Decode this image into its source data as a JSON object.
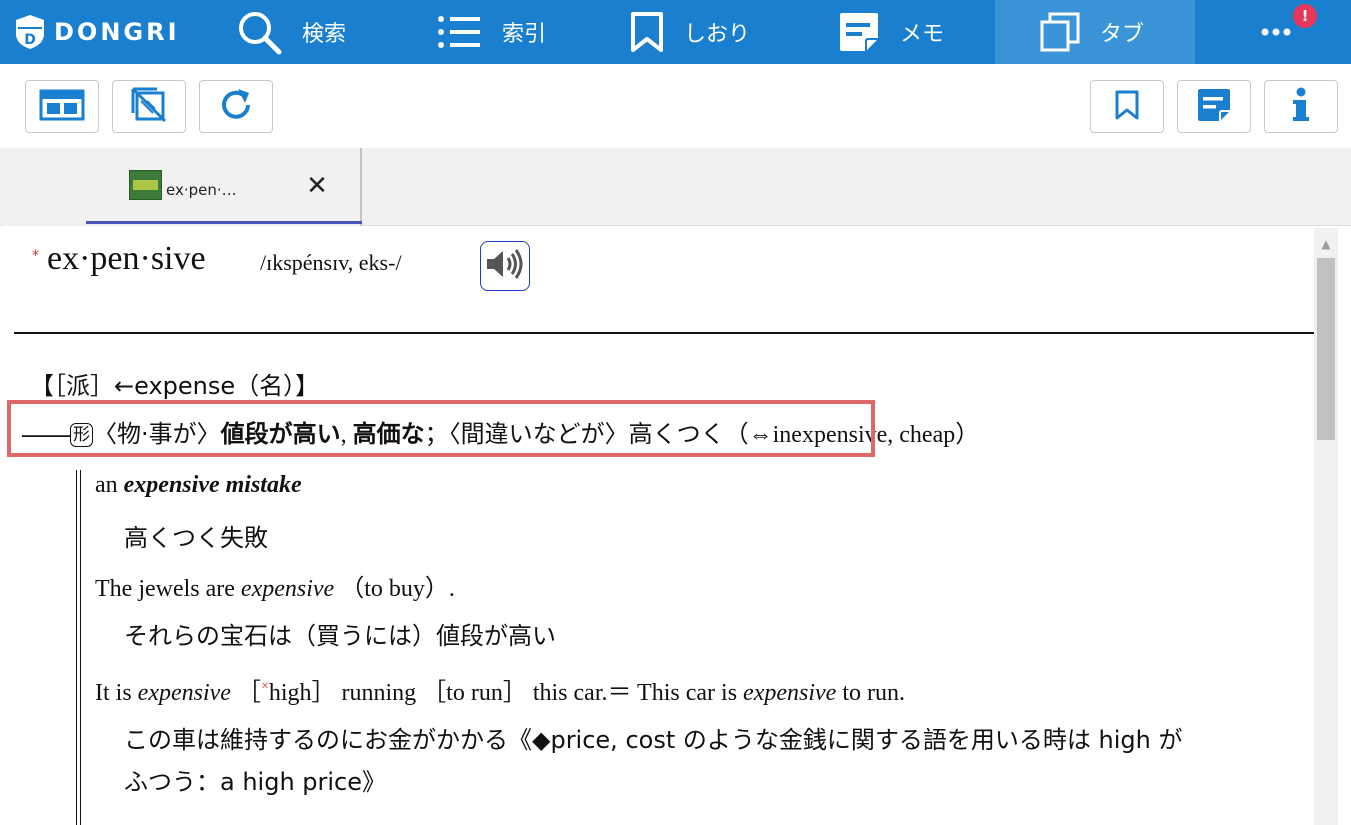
{
  "app": {
    "logo_text": "DONGRI",
    "nav": [
      {
        "label": "検索",
        "icon": "search-icon"
      },
      {
        "label": "索引",
        "icon": "list-icon"
      },
      {
        "label": "しおり",
        "icon": "bookmark-icon"
      },
      {
        "label": "メモ",
        "icon": "memo-icon"
      },
      {
        "label": "タブ",
        "icon": "tabs-icon"
      }
    ],
    "more_icon": "more-icon",
    "badge": "!",
    "accent_color": "#1a7fcf",
    "badge_color": "#e8385a",
    "highlight_color": "#e06767"
  },
  "toolbar": {
    "left_buttons": [
      "layout-icon",
      "no-image-icon",
      "refresh-icon"
    ],
    "right_buttons": [
      "bookmark-icon",
      "memo-icon",
      "info-icon"
    ]
  },
  "tab": {
    "title": "ex·pen·…",
    "close": "✕"
  },
  "entry": {
    "star": "*",
    "headword": "ex·pen·sive",
    "pronunciation": "/ɪkspénsɪv, eks-/",
    "derivation": {
      "open": "【［派］←expense（名）】"
    },
    "sense": {
      "dash": "――",
      "pos": "形",
      "subject": "〈物·事が〉",
      "meaning1": "値段が高い",
      "sep1": ", ",
      "meaning2": "高価な",
      "sep2": "；",
      "subject2": "〈間違いなどが〉",
      "meaning3": "高くつく",
      "antonym": "（⇔inexpensive, cheap）"
    },
    "examples": [
      {
        "en_prefix": "an ",
        "en_italic": "expensive mistake",
        "en_suffix": "",
        "ja": "高くつく失敗"
      },
      {
        "en_prefix": "The jewels are ",
        "en_italic": "expensive",
        "en_suffix": " （to buy）.",
        "ja": "それらの宝石は（買うには）値段が高い"
      },
      {
        "en_prefix": "It is ",
        "en_italic": "expensive",
        "en_mid1": " ［",
        "cross": "×",
        "en_mid2": "high］ running ［to run］ this car.＝ This car is ",
        "en_italic2": "expensive",
        "en_suffix": " to run.",
        "ja": "この車は維持するのにお金がかかる《◆price, cost のような金銭に関する語を用いる時は high が",
        "ja2": "ふつう：a high price》"
      }
    ]
  }
}
